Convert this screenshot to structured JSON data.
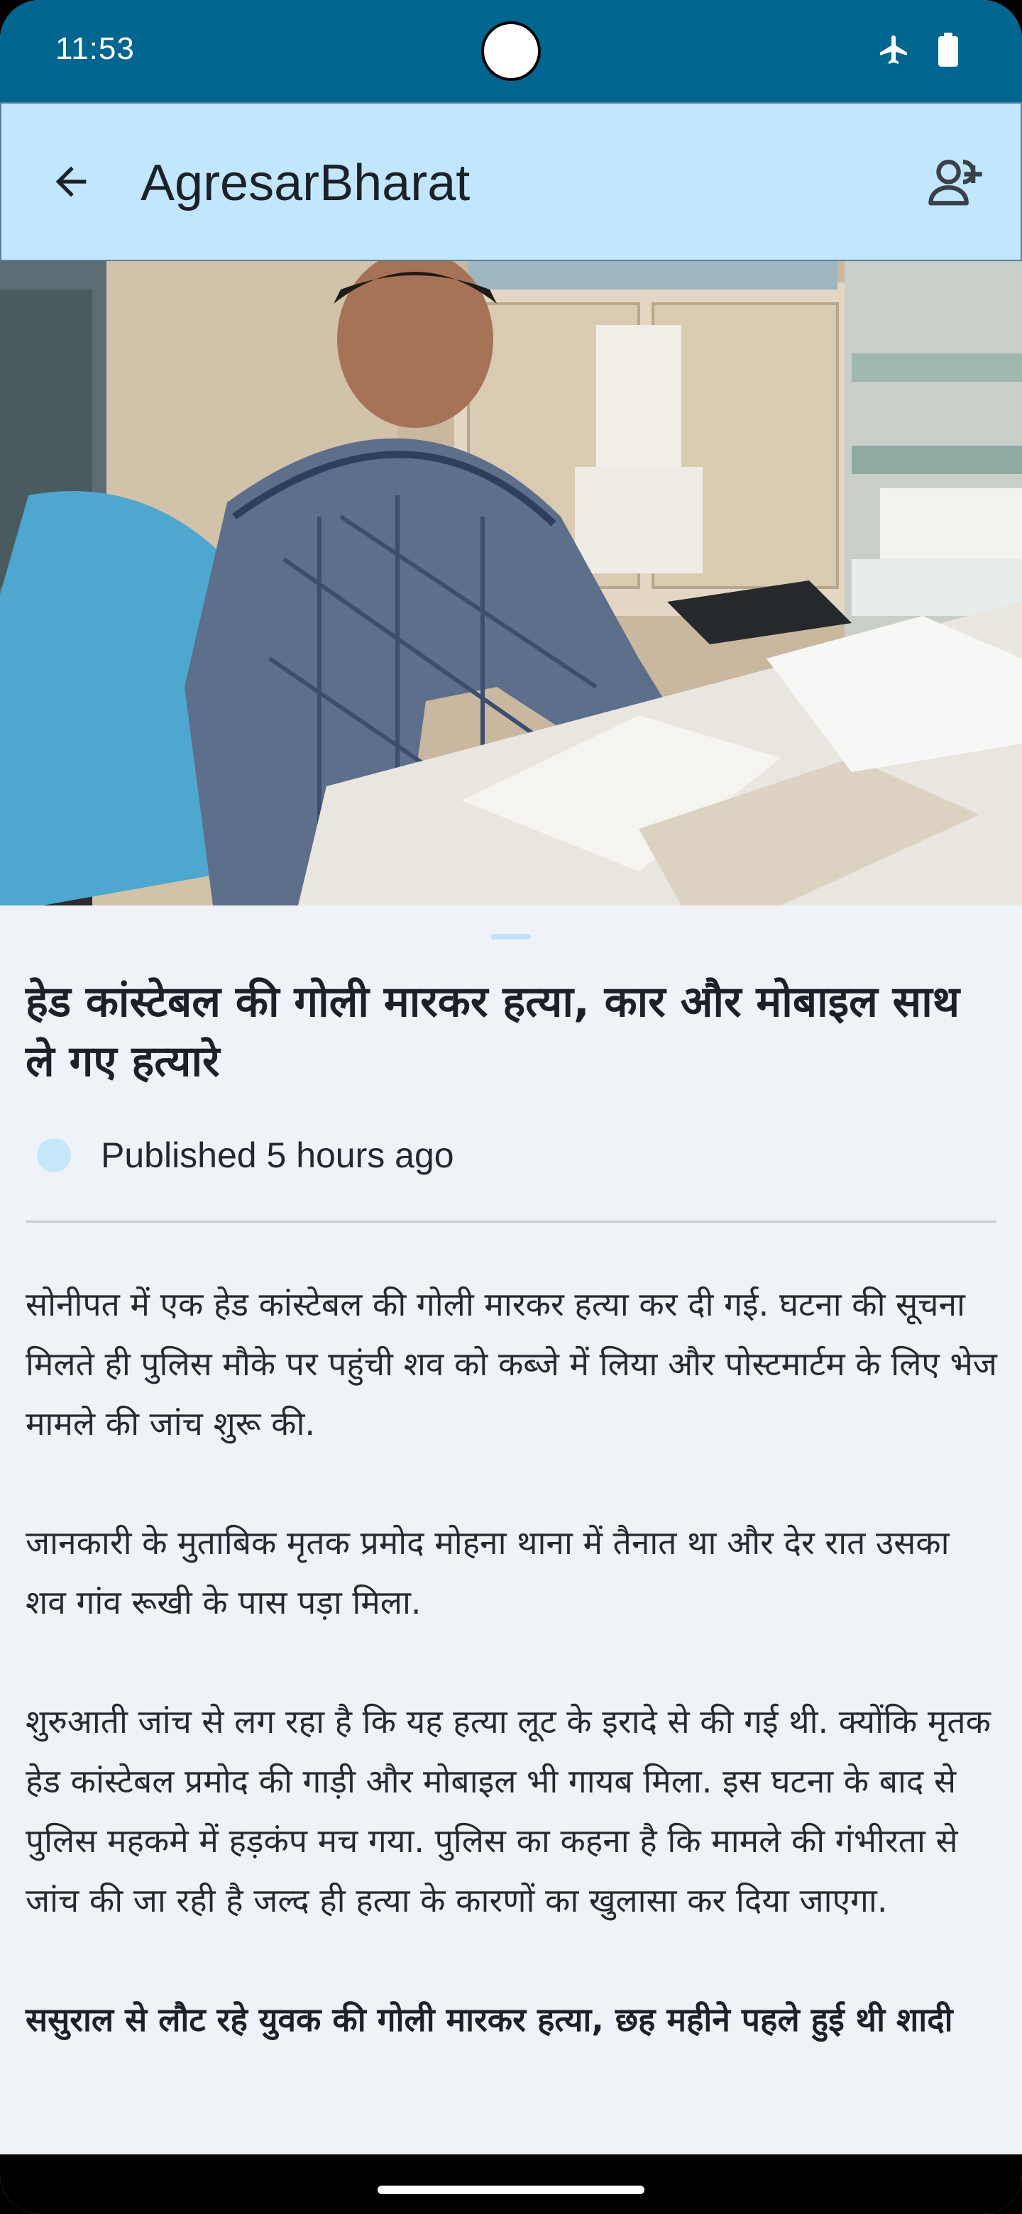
{
  "status_bar": {
    "time": "11:53",
    "icons": [
      "airplane-mode-icon",
      "battery-icon"
    ]
  },
  "app_bar": {
    "title": "AgresarBharat",
    "back_icon": "arrow-left-icon",
    "follow_icon": "person-add-icon"
  },
  "article": {
    "headline": "हेड कांस्टेबल की गोली मारकर हत्या, कार और मोबाइल साथ ले गए हत्यारे",
    "published": "Published 5 hours ago",
    "paragraphs": [
      "सोनीपत में एक हेड कांस्टेबल की गोली मारकर हत्या कर दी गई. घटना की सूचना मिलते ही पुलिस मौके पर पहुंची शव को कब्जे में लिया और पोस्टमार्टम के लिए भेज मामले की जांच शुरू की.",
      "जानकारी के मुताबिक मृतक प्रमोद मोहना थाना में तैनात था और देर रात उसका शव गांव रूखी के पास पड़ा मिला.",
      "शुरुआती जांच से लग रहा है कि यह हत्या लूट के इरादे से की गई थी. क्योंकि मृतक हेड कांस्टेबल प्रमोद की गाड़ी और मोबाइल भी गायब मिला. इस घटना के बाद से पुलिस महकमे में हड़कंप मच गया. पुलिस का कहना है कि मामले की गंभीरता से जांच की जा रही है जल्द ही हत्या के कारणों का खुलासा कर दिया जाएगा."
    ],
    "subheading": "ससुराल से लौट रहे युवक की गोली मारकर हत्या, छह महीने पहले हुई थी शादी"
  },
  "colors": {
    "status_bar": "#01668f",
    "app_bar": "#c2e6fd",
    "page_bg": "#eff3f8"
  }
}
